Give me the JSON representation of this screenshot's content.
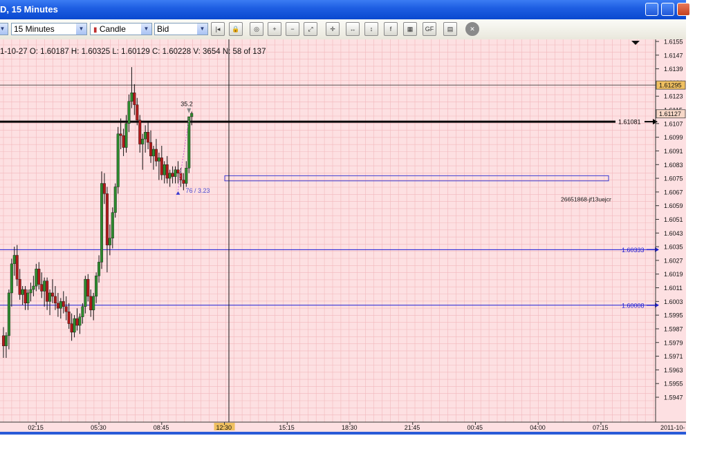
{
  "window": {
    "title": "D, 15 Minutes"
  },
  "toolbar": {
    "timeframe": "15 Minutes",
    "chart_style": "Candle",
    "price_type": "Bid",
    "tools": [
      "first-bar-icon",
      "lock-icon",
      "zoom-icon",
      "zoom-in-icon",
      "zoom-out-icon",
      "zoom-fit-icon",
      "crosshair-icon",
      "scroll-icon",
      "scale-icon",
      "indicator-icon",
      "strategy-icon",
      "gf-icon",
      "save-icon",
      "close-icon"
    ]
  },
  "info_line": "1-10-27  O: 1.60187  H: 1.60325  L: 1.60129  C: 1.60228  V: 3654  N: 58 of 137",
  "colors": {
    "background": "#fde0e2",
    "grid": "#f2b7bc",
    "up": "#2e8b2e",
    "down": "#b11b1b",
    "hline": "#1a1ad6"
  },
  "chart_data": {
    "type": "candlestick",
    "ylim": [
      1.5947,
      1.6155
    ],
    "y_ticks": [
      "1.6155",
      "1.6147",
      "1.6139",
      "1.6131",
      "1.6123",
      "1.6115",
      "1.6107",
      "1.6099",
      "1.6091",
      "1.6083",
      "1.6075",
      "1.6067",
      "1.6059",
      "1.6051",
      "1.6043",
      "1.6035",
      "1.6027",
      "1.6019",
      "1.6011",
      "1.6003",
      "1.5995",
      "1.5987",
      "1.5979",
      "1.5971",
      "1.5963",
      "1.5955",
      "1.5947"
    ],
    "x_ticks": [
      "02:15",
      "05:30",
      "08:45",
      "12:30",
      "15:15",
      "18:30",
      "21:45",
      "00:45",
      "04:00",
      "07:15"
    ],
    "x_tick_candles": [
      12,
      35,
      58,
      81,
      104,
      127,
      150,
      173,
      196,
      219
    ],
    "highlight_tick": "12:30",
    "date_label": "2011-10-",
    "crosshair_price": "1.61295",
    "last_price": "1.61127",
    "horizontal_lines": [
      {
        "price": 1.60333,
        "label": "1.60333",
        "style": "blue"
      },
      {
        "price": 1.60008,
        "label": "1.60008",
        "style": "blue"
      },
      {
        "price": 1.61081,
        "label": "1.61081",
        "style": "black-thick"
      },
      {
        "price": 1.61295,
        "label": "",
        "style": "thin-black"
      }
    ],
    "annotations": [
      {
        "text": "35.2"
      },
      {
        "text": "76 / 3.23"
      },
      {
        "text": "26651868-jf13uejcr"
      }
    ],
    "candles": [
      [
        1.5983,
        1.5988,
        1.597,
        1.5977
      ],
      [
        1.5977,
        1.5985,
        1.597,
        1.5983
      ],
      [
        1.5983,
        1.601,
        1.5975,
        1.6008
      ],
      [
        1.6008,
        1.6028,
        1.6,
        1.6025
      ],
      [
        1.6025,
        1.6035,
        1.6018,
        1.603
      ],
      [
        1.603,
        1.6036,
        1.6012,
        1.6016
      ],
      [
        1.6016,
        1.6022,
        1.6004,
        1.6007
      ],
      [
        1.6007,
        1.6012,
        1.6001,
        1.601
      ],
      [
        1.601,
        1.6012,
        1.5998,
        1.6002
      ],
      [
        1.6002,
        1.601,
        1.5998,
        1.6008
      ],
      [
        1.6008,
        1.6014,
        1.6003,
        1.601
      ],
      [
        1.601,
        1.6018,
        1.6006,
        1.6012
      ],
      [
        1.6012,
        1.6025,
        1.6009,
        1.6022
      ],
      [
        1.6022,
        1.6026,
        1.601,
        1.6013
      ],
      [
        1.6013,
        1.602,
        1.6005,
        1.6009
      ],
      [
        1.6009,
        1.6017,
        1.6,
        1.6015
      ],
      [
        1.6015,
        1.6017,
        1.5998,
        1.6003
      ],
      [
        1.6003,
        1.601,
        1.5995,
        1.6008
      ],
      [
        1.6008,
        1.6016,
        1.6002,
        1.6006
      ],
      [
        1.6006,
        1.6012,
        1.5998,
        1.6002
      ],
      [
        1.6002,
        1.6008,
        1.5994,
        1.5999
      ],
      [
        1.5999,
        1.6005,
        1.5993,
        1.6003
      ],
      [
        1.6003,
        1.6009,
        1.5996,
        1.6
      ],
      [
        1.6,
        1.6006,
        1.5992,
        1.5997
      ],
      [
        1.5997,
        1.6002,
        1.5987,
        1.599
      ],
      [
        1.599,
        1.5996,
        1.598,
        1.5985
      ],
      [
        1.5985,
        1.5995,
        1.5982,
        1.5993
      ],
      [
        1.5993,
        1.5999,
        1.5986,
        1.5989
      ],
      [
        1.5989,
        1.5996,
        1.5984,
        1.5994
      ],
      [
        1.5994,
        1.6002,
        1.599,
        1.6
      ],
      [
        1.6,
        1.6018,
        1.5996,
        1.6016
      ],
      [
        1.6016,
        1.6019,
        1.6003,
        1.6006
      ],
      [
        1.6006,
        1.601,
        1.5994,
        1.5998
      ],
      [
        1.5998,
        1.6008,
        1.5992,
        1.6006
      ],
      [
        1.6006,
        1.602,
        1.6002,
        1.6018
      ],
      [
        1.6018,
        1.603,
        1.6014,
        1.6026
      ],
      [
        1.6026,
        1.6079,
        1.6022,
        1.6072
      ],
      [
        1.6072,
        1.6078,
        1.606,
        1.6066
      ],
      [
        1.6066,
        1.607,
        1.602,
        1.6036
      ],
      [
        1.6036,
        1.6048,
        1.603,
        1.604
      ],
      [
        1.604,
        1.6058,
        1.6034,
        1.6055
      ],
      [
        1.6055,
        1.6072,
        1.6052,
        1.607
      ],
      [
        1.607,
        1.6105,
        1.6066,
        1.6101
      ],
      [
        1.6101,
        1.611,
        1.6092,
        1.61
      ],
      [
        1.61,
        1.6104,
        1.6088,
        1.6093
      ],
      [
        1.6093,
        1.6112,
        1.609,
        1.6107
      ],
      [
        1.6107,
        1.6124,
        1.6102,
        1.612
      ],
      [
        1.612,
        1.614,
        1.6116,
        1.6125
      ],
      [
        1.6125,
        1.613,
        1.6112,
        1.6118
      ],
      [
        1.6118,
        1.6122,
        1.6106,
        1.6109
      ],
      [
        1.6109,
        1.6112,
        1.609,
        1.6095
      ],
      [
        1.6095,
        1.6101,
        1.608,
        1.6098
      ],
      [
        1.6098,
        1.6106,
        1.609,
        1.6102
      ],
      [
        1.6102,
        1.6108,
        1.6092,
        1.6096
      ],
      [
        1.6096,
        1.6103,
        1.6084,
        1.6088
      ],
      [
        1.6088,
        1.6094,
        1.608,
        1.6092
      ],
      [
        1.6092,
        1.6098,
        1.6082,
        1.6085
      ],
      [
        1.6085,
        1.609,
        1.6074,
        1.6087
      ],
      [
        1.6087,
        1.6094,
        1.6074,
        1.6077
      ],
      [
        1.6077,
        1.6085,
        1.6072,
        1.6083
      ],
      [
        1.6083,
        1.6088,
        1.6072,
        1.6075
      ],
      [
        1.6075,
        1.608,
        1.607,
        1.6078
      ],
      [
        1.6078,
        1.6082,
        1.6072,
        1.6076
      ],
      [
        1.6076,
        1.6082,
        1.6072,
        1.608
      ],
      [
        1.608,
        1.6085,
        1.6072,
        1.6078
      ],
      [
        1.6078,
        1.6081,
        1.607,
        1.6074
      ],
      [
        1.6074,
        1.6078,
        1.6068,
        1.6072
      ],
      [
        1.6072,
        1.6085,
        1.607,
        1.6081
      ],
      [
        1.6081,
        1.6105,
        1.6078,
        1.6111
      ],
      [
        1.6111,
        1.6114,
        1.6106,
        1.6113
      ]
    ]
  }
}
